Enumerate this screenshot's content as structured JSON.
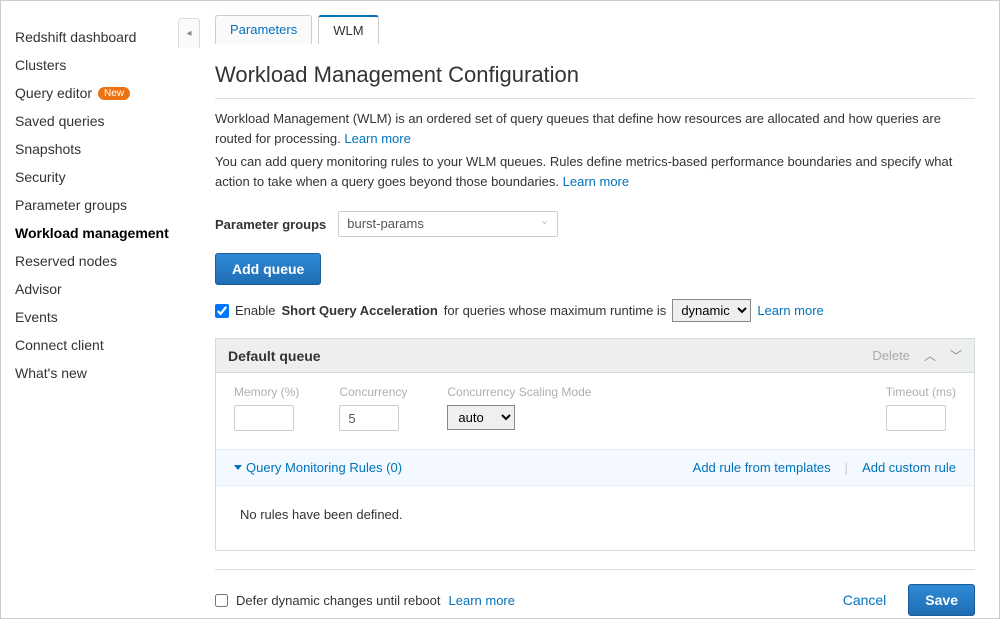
{
  "sidebar": {
    "items": [
      {
        "label": "Redshift dashboard",
        "active": false,
        "badge": null
      },
      {
        "label": "Clusters",
        "active": false,
        "badge": null
      },
      {
        "label": "Query editor",
        "active": false,
        "badge": "New"
      },
      {
        "label": "Saved queries",
        "active": false,
        "badge": null
      },
      {
        "label": "Snapshots",
        "active": false,
        "badge": null
      },
      {
        "label": "Security",
        "active": false,
        "badge": null
      },
      {
        "label": "Parameter groups",
        "active": false,
        "badge": null
      },
      {
        "label": "Workload management",
        "active": true,
        "badge": null
      },
      {
        "label": "Reserved nodes",
        "active": false,
        "badge": null
      },
      {
        "label": "Advisor",
        "active": false,
        "badge": null
      },
      {
        "label": "Events",
        "active": false,
        "badge": null
      },
      {
        "label": "Connect client",
        "active": false,
        "badge": null
      },
      {
        "label": "What's new",
        "active": false,
        "badge": null
      }
    ]
  },
  "tabs": {
    "parameters": "Parameters",
    "wlm": "WLM"
  },
  "page": {
    "title": "Workload Management Configuration",
    "desc1": "Workload Management (WLM) is an ordered set of query queues that define how resources are allocated and how queries are routed for processing.  ",
    "desc2": "You can add query monitoring rules to your WLM queues. Rules define metrics-based performance boundaries and specify what action to take when a query goes beyond those boundaries.  ",
    "learn_more": "Learn more"
  },
  "param_group": {
    "label": "Parameter groups",
    "selected": "burst-params"
  },
  "buttons": {
    "add_queue": "Add queue",
    "cancel": "Cancel",
    "save": "Save"
  },
  "sqa": {
    "pre": "Enable ",
    "strong": "Short Query Acceleration",
    "post": " for queries whose maximum runtime is ",
    "value": "dynamic",
    "learn_more": "Learn more",
    "checked": true
  },
  "queue": {
    "title": "Default queue",
    "delete": "Delete",
    "fields": {
      "memory_label": "Memory (%)",
      "memory_value": "",
      "concurrency_label": "Concurrency",
      "concurrency_value": "5",
      "scaling_label": "Concurrency Scaling Mode",
      "scaling_value": "auto",
      "timeout_label": "Timeout (ms)",
      "timeout_value": ""
    },
    "qmr": {
      "toggle": "Query Monitoring Rules (0)",
      "add_template": "Add rule from templates",
      "add_custom": "Add custom rule",
      "empty": "No rules have been defined."
    }
  },
  "footer": {
    "defer": "Defer dynamic changes until reboot",
    "learn_more": "Learn more",
    "defer_checked": false
  }
}
